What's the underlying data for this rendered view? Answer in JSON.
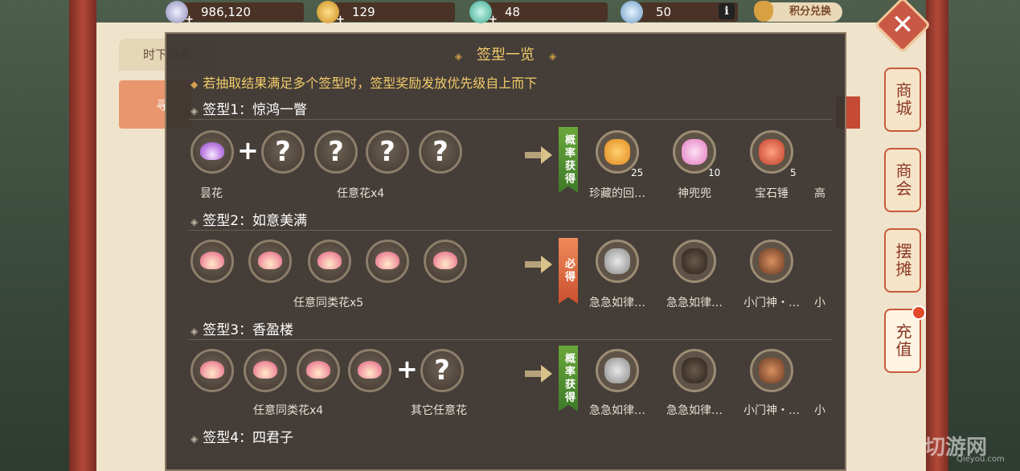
{
  "topbar": {
    "silver": "986,120",
    "gold": "129",
    "jade": "48",
    "energy": "50",
    "info_icon": "i",
    "exchange_label": "积分兑换"
  },
  "background": {
    "tab_label": "时下热卖",
    "orange_tag": "寻"
  },
  "side_tabs": [
    "商城",
    "商会",
    "摆摊",
    "充值"
  ],
  "overlay": {
    "title": "签型一览",
    "note": "若抽取结果满足多个签型时，签型奖励发放优先级自上而下",
    "sections": [
      {
        "heading": "签型1：惊鸿一瞥",
        "left_labels": [
          "昙花",
          "任意花x4"
        ],
        "ribbon": "概率获得",
        "rewards": [
          {
            "name": "珍藏的回…",
            "count": "25",
            "icon": "treasure-icon"
          },
          {
            "name": "神兜兜",
            "count": "10",
            "icon": "pink-creature-icon"
          },
          {
            "name": "宝石锤",
            "count": "5",
            "icon": "gem-hammer-icon"
          },
          {
            "name": "高",
            "count": "",
            "icon": ""
          }
        ]
      },
      {
        "heading": "签型2：如意美满",
        "left_labels": [
          "任意同类花x5"
        ],
        "ribbon": "必得",
        "rewards": [
          {
            "name": "急急如律…",
            "count": "",
            "icon": "outfit-icon"
          },
          {
            "name": "急急如律…",
            "count": "",
            "icon": "outfit-icon"
          },
          {
            "name": "小门神・…",
            "count": "",
            "icon": "door-god-icon"
          },
          {
            "name": "小",
            "count": "",
            "icon": ""
          }
        ]
      },
      {
        "heading": "签型3：香盈楼",
        "left_labels": [
          "任意同类花x4",
          "其它任意花"
        ],
        "ribbon": "概率获得",
        "rewards": [
          {
            "name": "急急如律…",
            "count": "",
            "icon": "outfit-icon"
          },
          {
            "name": "急急如律…",
            "count": "",
            "icon": "outfit-icon"
          },
          {
            "name": "小门神・…",
            "count": "",
            "icon": "door-god-icon"
          },
          {
            "name": "小",
            "count": "",
            "icon": ""
          }
        ]
      },
      {
        "heading": "签型4：四君子"
      }
    ]
  },
  "watermark": {
    "main": "切游网",
    "sub": "Qieyou.com"
  },
  "colors": {
    "accent": "#f2cc6a",
    "frame": "#b4493a",
    "overlay": "#3a342f"
  }
}
